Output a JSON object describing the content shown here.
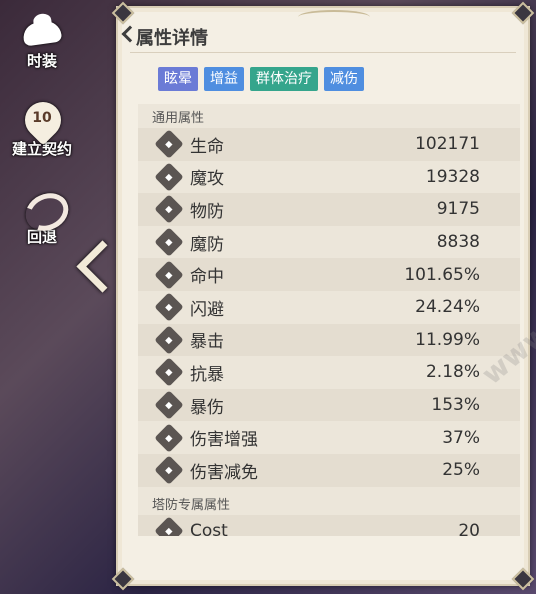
{
  "sidebar": {
    "costume_label": "时装",
    "contract_label": "建立契约",
    "contract_level": "10",
    "undo_label": "回退"
  },
  "back": {
    "label": "返回"
  },
  "panel": {
    "title": "属性详情",
    "tags": [
      {
        "label": "眩晕",
        "color": "#6b7bd6"
      },
      {
        "label": "增益",
        "color": "#4f8ee0"
      },
      {
        "label": "群体治疗",
        "color": "#35a58c"
      },
      {
        "label": "减伤",
        "color": "#4f8ee0"
      }
    ],
    "general_section": "通用属性",
    "stats": [
      {
        "name": "生命",
        "value": "102171",
        "icon": "heart-icon"
      },
      {
        "name": "魔攻",
        "value": "19328",
        "icon": "staff-icon"
      },
      {
        "name": "物防",
        "value": "9175",
        "icon": "shield-icon"
      },
      {
        "name": "魔防",
        "value": "8838",
        "icon": "magic-shield-icon"
      },
      {
        "name": "命中",
        "value": "101.65%",
        "icon": "target-icon"
      },
      {
        "name": "闪避",
        "value": "24.24%",
        "icon": "dodge-icon"
      },
      {
        "name": "暴击",
        "value": "11.99%",
        "icon": "crit-icon"
      },
      {
        "name": "抗暴",
        "value": "2.18%",
        "icon": "crit-resist-icon"
      },
      {
        "name": "暴伤",
        "value": "153%",
        "icon": "crit-damage-icon"
      },
      {
        "name": "伤害增强",
        "value": "37%",
        "icon": "damage-boost-icon"
      },
      {
        "name": "伤害减免",
        "value": "25%",
        "icon": "damage-reduce-icon"
      }
    ],
    "tower_section": "塔防专属属性",
    "tower_stats": [
      {
        "name": "Cost",
        "value": "20",
        "icon": "cost-icon"
      }
    ]
  },
  "watermark": {
    "text": "www.hackhome.com"
  }
}
